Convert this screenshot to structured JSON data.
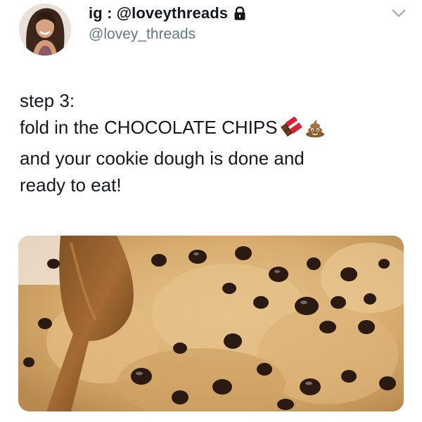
{
  "account": {
    "display_name": "ig : @loveythreads",
    "handle": "@lovey_threads",
    "avatar_icon": "avatar-photo",
    "protected_icon": "lock-icon",
    "menu_icon": "chevron-down-icon"
  },
  "tweet": {
    "lines": [
      "step 3:",
      "fold in the CHOCOLATE CHIPS",
      "and your cookie dough is done and",
      "ready to eat!"
    ],
    "emojis": [
      "chocolate-bar-emoji",
      "pile-of-poo-emoji"
    ]
  },
  "media": {
    "image": "cookie-dough-photo"
  },
  "colors": {
    "text": "#141823",
    "secondary_text": "#657786",
    "background": "#ffffff"
  }
}
